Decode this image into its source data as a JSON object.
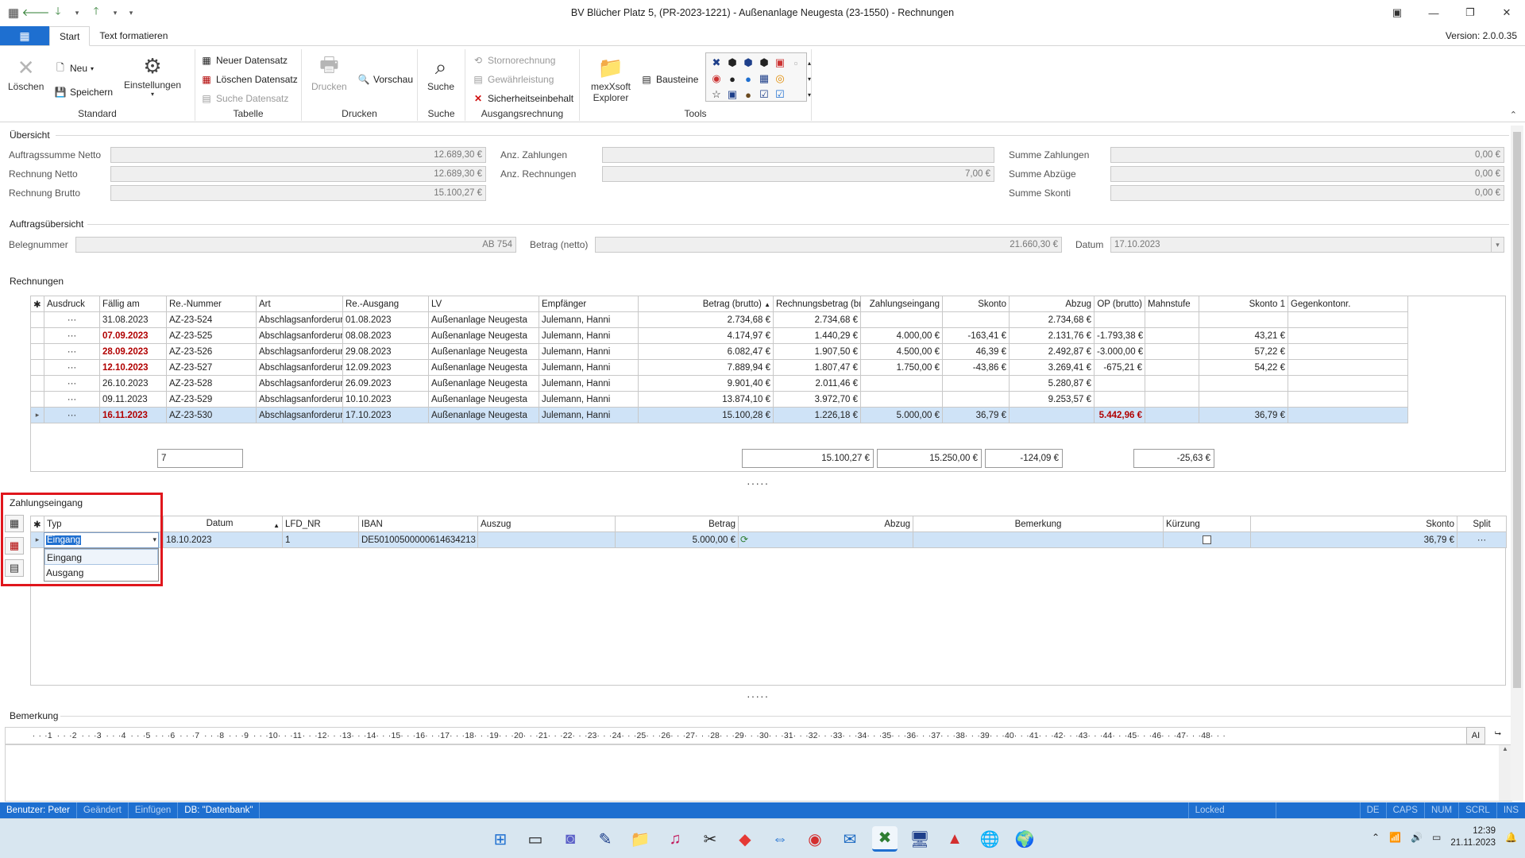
{
  "window": {
    "title": "BV Blücher Platz 5, (PR-2023-1221) - Außenanlage Neugesta (23-1550) - Rechnungen",
    "version": "Version: 2.0.0.35"
  },
  "ribbon": {
    "tabs": [
      "Start",
      "Text formatieren"
    ],
    "groups": {
      "standard": {
        "label": "Standard",
        "loeschen": "Löschen",
        "neu": "Neu",
        "speichern": "Speichern",
        "einstellungen": "Einstellungen"
      },
      "tabelle": {
        "label": "Tabelle",
        "neuer": "Neuer Datensatz",
        "loeschen": "Löschen Datensatz",
        "suche": "Suche Datensatz"
      },
      "drucken": {
        "label": "Drucken",
        "drucken": "Drucken",
        "vorschau": "Vorschau"
      },
      "suche": {
        "label": "Suche",
        "suche": "Suche"
      },
      "ausgang": {
        "label": "Ausgangsrechnung",
        "storno": "Stornorechnung",
        "gewaehr": "Gewährleistung",
        "sicherheit": "Sicherheitseinbehalt"
      },
      "tools": {
        "label": "Tools",
        "explorer": "mexXsoft Explorer",
        "bausteine": "Bausteine"
      }
    }
  },
  "uebersicht": {
    "title": "Übersicht",
    "auftragssumme_netto": {
      "label": "Auftragssumme Netto",
      "value": "12.689,30 €"
    },
    "rechnung_netto": {
      "label": "Rechnung Netto",
      "value": "12.689,30 €"
    },
    "rechnung_brutto": {
      "label": "Rechnung Brutto",
      "value": "15.100,27 €"
    },
    "anz_zahlungen": {
      "label": "Anz. Zahlungen",
      "value": ""
    },
    "anz_rechnungen": {
      "label": "Anz. Rechnungen",
      "value": "7,00 €"
    },
    "summe_zahlungen": {
      "label": "Summe Zahlungen",
      "value": "0,00 €"
    },
    "summe_abzuege": {
      "label": "Summe Abzüge",
      "value": "0,00 €"
    },
    "summe_skonti": {
      "label": "Summe Skonti",
      "value": "0,00 €"
    }
  },
  "auftrag": {
    "title": "Auftragsübersicht",
    "belegnummer": {
      "label": "Belegnummer",
      "value": "AB 754"
    },
    "betrag": {
      "label": "Betrag (netto)",
      "value": "21.660,30 €"
    },
    "datum": {
      "label": "Datum",
      "value": "17.10.2023"
    }
  },
  "rechnungen": {
    "title": "Rechnungen",
    "columns": [
      "Ausdruck",
      "Fällig am",
      "Re.-Nummer",
      "Art",
      "Re.-Ausgang",
      "LV",
      "Empfänger",
      "Betrag (brutto)",
      "Rechnungsbetrag (brutto)",
      "Zahlungseingang",
      "Skonto",
      "Abzug",
      "OP (brutto)",
      "Mahnstufe",
      "Skonto 1",
      "Gegenkontonr."
    ],
    "rows": [
      {
        "ausdruck": "···",
        "faellig": "31.08.2023",
        "overdue": false,
        "nr": "AZ-23-524",
        "art": "Abschlagsanforderung",
        "ausgang": "01.08.2023",
        "lv": "Außenanlage Neugesta",
        "empf": "Julemann, Hanni",
        "betrag": "2.734,68 €",
        "rbetrag": "2.734,68 €",
        "zahlung": "",
        "skonto": "",
        "abzug": "2.734,68 €",
        "op": "",
        "mahn": "",
        "skonto1": "",
        "gegen": ""
      },
      {
        "ausdruck": "···",
        "faellig": "07.09.2023",
        "overdue": true,
        "nr": "AZ-23-525",
        "art": "Abschlagsanforderung",
        "ausgang": "08.08.2023",
        "lv": "Außenanlage Neugesta",
        "empf": "Julemann, Hanni",
        "betrag": "4.174,97 €",
        "rbetrag": "1.440,29 €",
        "zahlung": "4.000,00 €",
        "skonto": "-163,41 €",
        "abzug": "2.131,76 €",
        "op": "-1.793,38 €",
        "mahn": "",
        "skonto1": "43,21 €",
        "gegen": ""
      },
      {
        "ausdruck": "···",
        "faellig": "28.09.2023",
        "overdue": true,
        "nr": "AZ-23-526",
        "art": "Abschlagsanforderung",
        "ausgang": "29.08.2023",
        "lv": "Außenanlage Neugesta",
        "empf": "Julemann, Hanni",
        "betrag": "6.082,47 €",
        "rbetrag": "1.907,50 €",
        "zahlung": "4.500,00 €",
        "skonto": "46,39 €",
        "abzug": "2.492,87 €",
        "op": "-3.000,00 €",
        "mahn": "",
        "skonto1": "57,22 €",
        "gegen": ""
      },
      {
        "ausdruck": "···",
        "faellig": "12.10.2023",
        "overdue": true,
        "nr": "AZ-23-527",
        "art": "Abschlagsanforderung",
        "ausgang": "12.09.2023",
        "lv": "Außenanlage Neugesta",
        "empf": "Julemann, Hanni",
        "betrag": "7.889,94 €",
        "rbetrag": "1.807,47 €",
        "zahlung": "1.750,00 €",
        "skonto": "-43,86 €",
        "abzug": "3.269,41 €",
        "op": "-675,21 €",
        "mahn": "",
        "skonto1": "54,22 €",
        "gegen": ""
      },
      {
        "ausdruck": "···",
        "faellig": "26.10.2023",
        "overdue": false,
        "nr": "AZ-23-528",
        "art": "Abschlagsanforderung",
        "ausgang": "26.09.2023",
        "lv": "Außenanlage Neugesta",
        "empf": "Julemann, Hanni",
        "betrag": "9.901,40 €",
        "rbetrag": "2.011,46 €",
        "zahlung": "",
        "skonto": "",
        "abzug": "5.280,87 €",
        "op": "",
        "mahn": "",
        "skonto1": "",
        "gegen": ""
      },
      {
        "ausdruck": "···",
        "faellig": "09.11.2023",
        "overdue": false,
        "nr": "AZ-23-529",
        "art": "Abschlagsanforderung",
        "ausgang": "10.10.2023",
        "lv": "Außenanlage Neugesta",
        "empf": "Julemann, Hanni",
        "betrag": "13.874,10 €",
        "rbetrag": "3.972,70 €",
        "zahlung": "",
        "skonto": "",
        "abzug": "9.253,57 €",
        "op": "",
        "mahn": "",
        "skonto1": "",
        "gegen": ""
      },
      {
        "ausdruck": "···",
        "faellig": "16.11.2023",
        "overdue": true,
        "nr": "AZ-23-530",
        "art": "Abschlagsanforderung",
        "ausgang": "17.10.2023",
        "lv": "Außenanlage Neugesta",
        "empf": "Julemann, Hanni",
        "betrag": "15.100,28 €",
        "rbetrag": "1.226,18 €",
        "zahlung": "5.000,00 €",
        "skonto": "36,79 €",
        "abzug": "",
        "op": "5.442,96 €",
        "mahn": "",
        "skonto1": "36,79 €",
        "gegen": "",
        "selected": true
      }
    ],
    "summary": {
      "count": "7",
      "rbetrag": "15.100,27 €",
      "zahlung": "15.250,00 €",
      "skonto": "-124,09 €",
      "op": "-25,63 €"
    }
  },
  "zahlungseingang": {
    "title": "Zahlungseingang",
    "columns": [
      "Typ",
      "Datum",
      "LFD_NR",
      "IBAN",
      "Auszug",
      "Betrag",
      "Abzug",
      "Bemerkung",
      "Kürzung",
      "Skonto",
      "Split"
    ],
    "row": {
      "typ": "Eingang",
      "datum": "18.10.2023",
      "lfd": "1",
      "iban": "DE50100500000614634213",
      "auszug": "",
      "betrag": "5.000,00 €",
      "abzug": "",
      "bemerkung": "",
      "skonto": "36,79 €",
      "split": "···"
    },
    "dropdown_options": [
      "Eingang",
      "Ausgang"
    ]
  },
  "bemerkung": {
    "title": "Bemerkung",
    "ai_label": "AI"
  },
  "status": {
    "benutzer": "Benutzer: Peter",
    "geaendert": "Geändert",
    "einfuegen": "Einfügen",
    "db": "DB: \"Datenbank\"",
    "locked": "Locked",
    "lang": "DE",
    "caps": "CAPS",
    "num": "NUM",
    "scrl": "SCRL",
    "ins": "INS"
  },
  "taskbar": {
    "time": "12:39",
    "date": "21.11.2023"
  }
}
